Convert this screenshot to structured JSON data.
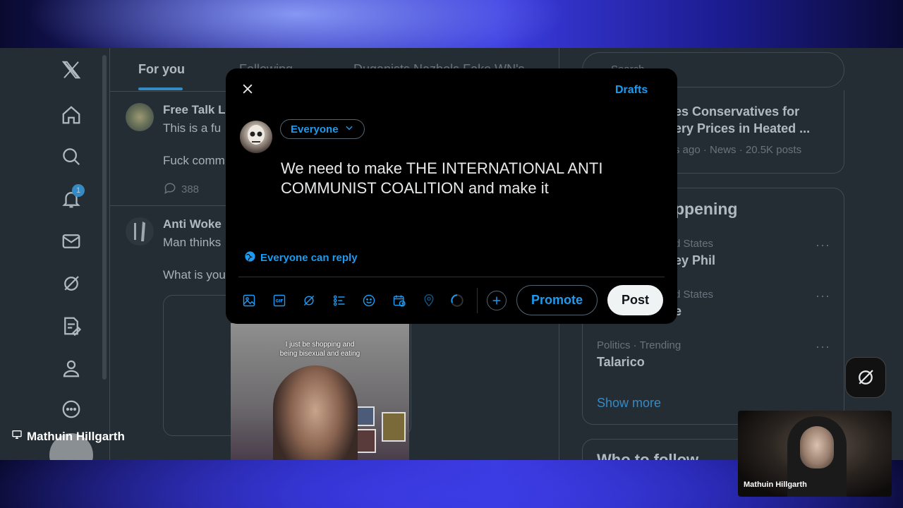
{
  "sidebar": {
    "logo": "X",
    "notification_count": "1",
    "icons": [
      "home-icon",
      "search-icon",
      "bell-icon",
      "mail-icon",
      "grok-icon",
      "compose-list-icon",
      "profile-icon",
      "more-icon"
    ]
  },
  "feed": {
    "tabs": [
      {
        "label": "For you",
        "active": true
      },
      {
        "label": "Following",
        "active": false
      },
      {
        "label": "Duganists Nazbols Fake WN's",
        "active": false
      }
    ],
    "posts": [
      {
        "name": "Free Talk L",
        "text1": "This is a fu",
        "text2": "Fuck comm",
        "replies": "388"
      },
      {
        "name": "Anti Woke",
        "text1": "Man thinks",
        "text2": "What is you"
      }
    ],
    "video_caption_line1": "I just be shopping and",
    "video_caption_line2": "being bisexual and eating"
  },
  "right": {
    "search_placeholder": "Search",
    "trend_top_title_line1": "es Conservatives for",
    "trend_top_title_line2": "ery Prices in Heated ...",
    "trend_top_meta": "s ago · News · 20.5K posts",
    "happening_title": "ppening",
    "trends": [
      {
        "meta": "d States",
        "title": "ey Phil"
      },
      {
        "meta": "d States",
        "title": "e"
      },
      {
        "meta": "Politics · Trending",
        "title": "Talarico"
      }
    ],
    "show_more": "Show more",
    "who_to_follow": "Who to follow"
  },
  "composer": {
    "drafts_label": "Drafts",
    "audience_label": "Everyone",
    "text": "We need to make THE INTERNATIONAL ANTI COMMUNIST COALITION and make it",
    "reply_setting": "Everyone can reply",
    "promote_label": "Promote",
    "post_label": "Post"
  },
  "overlay": {
    "streamer_name": "Mathuin Hillgarth",
    "webcam_name": "Mathuin Hillgarth"
  },
  "colors": {
    "accent": "#1d9bf0",
    "background": "#000000",
    "text": "#e7e9ea",
    "muted": "#71767b"
  }
}
